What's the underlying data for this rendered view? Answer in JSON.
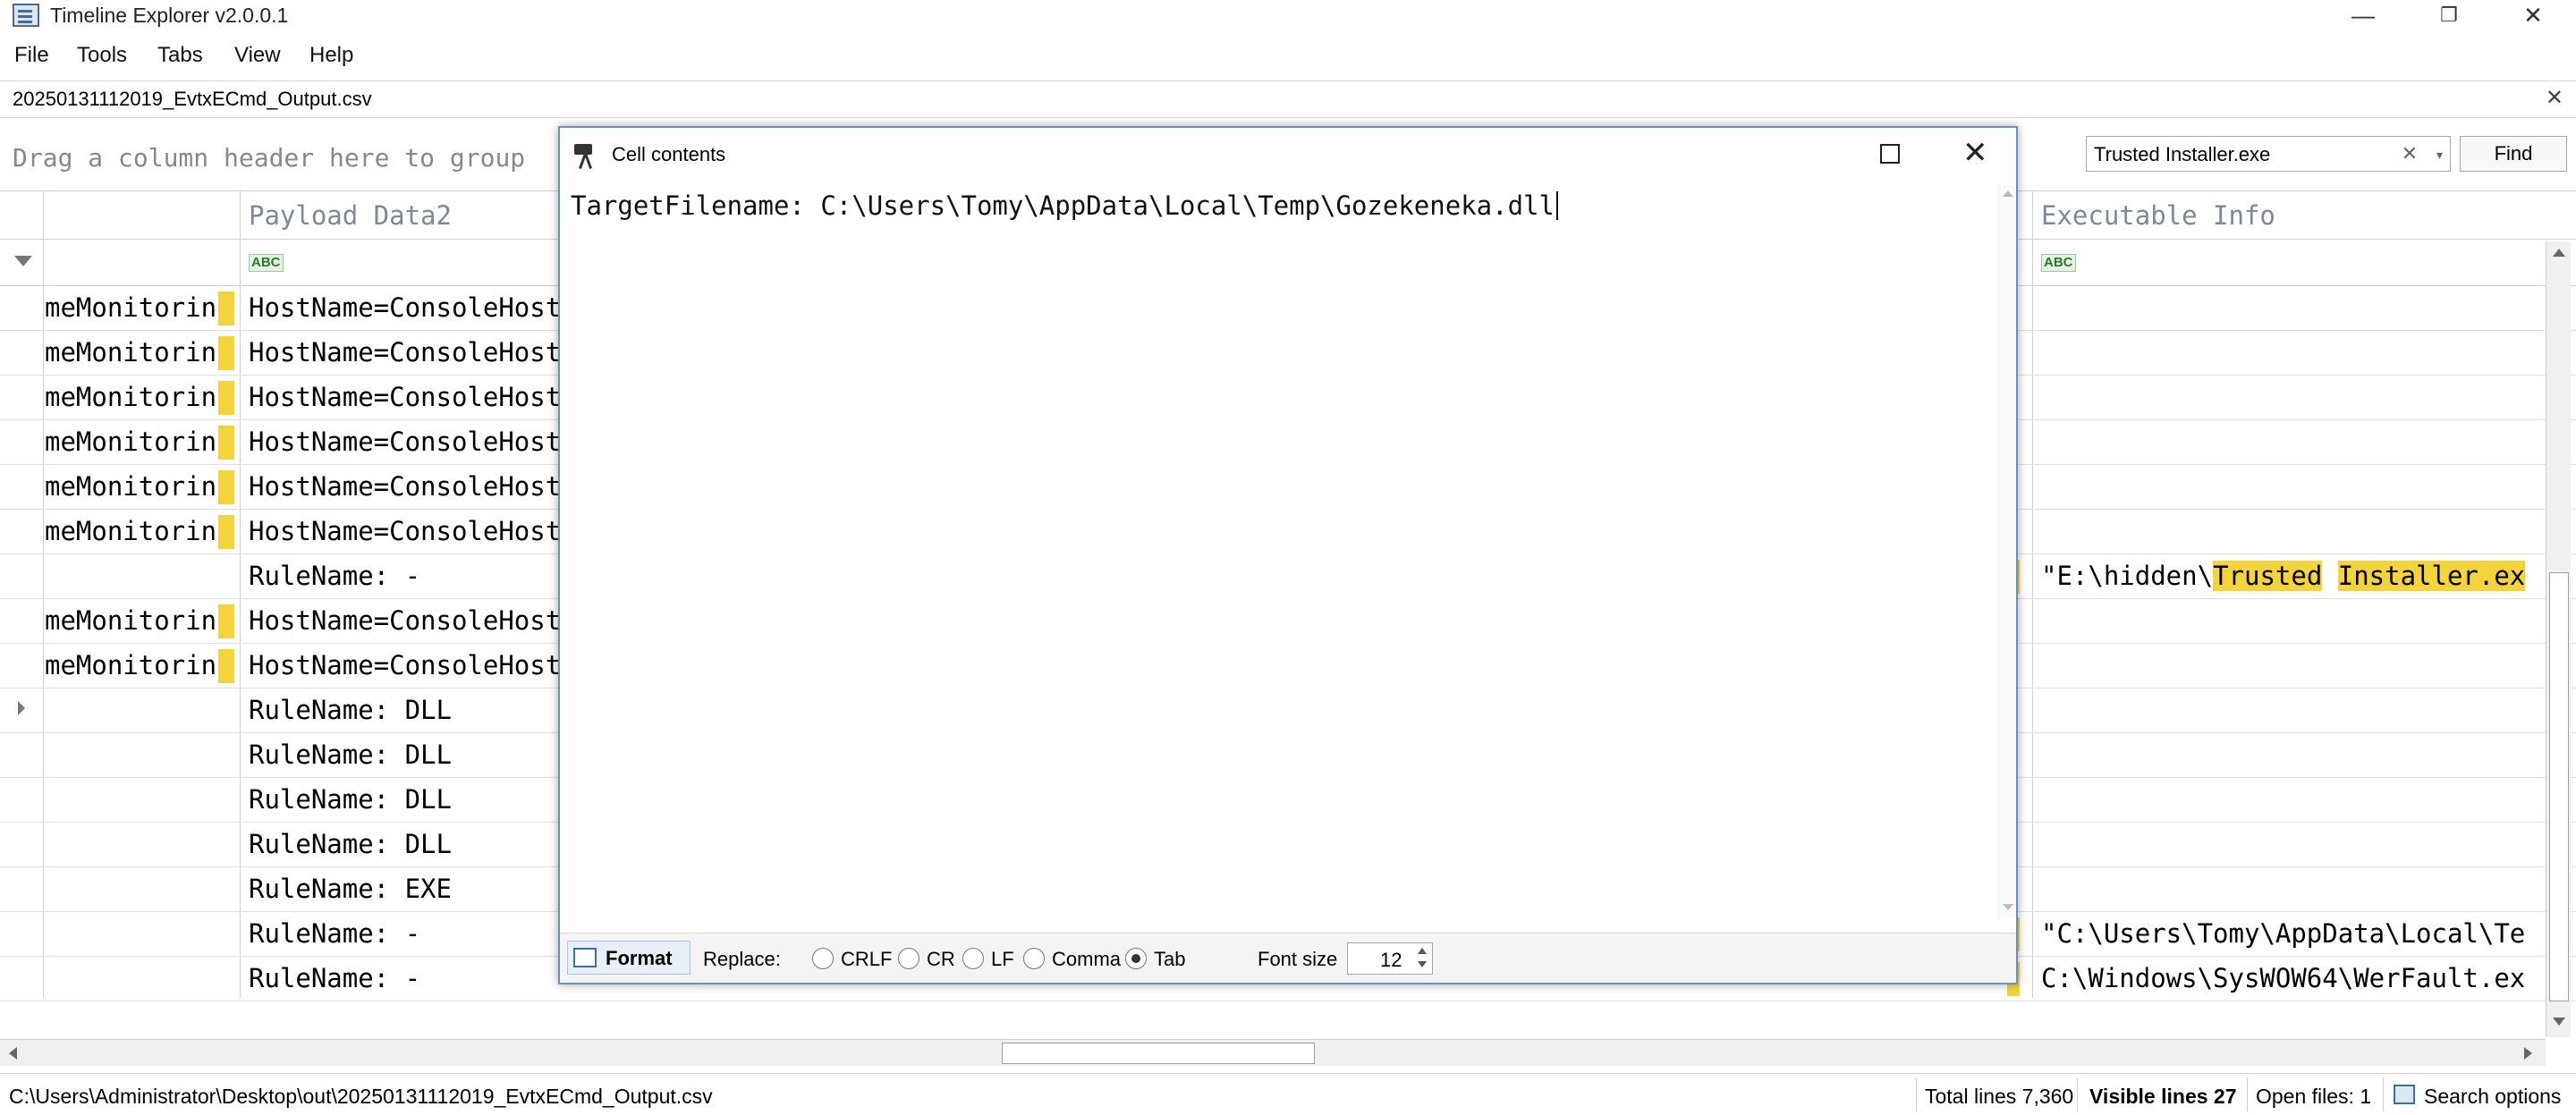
{
  "window": {
    "title": "Timeline Explorer v2.0.0.1",
    "minimize": "—",
    "restore": "❐",
    "close": "✕"
  },
  "menu": [
    "File",
    "Tools",
    "Tabs",
    "View",
    "Help"
  ],
  "file_tab": {
    "label": "20250131112019_EvtxECmd_Output.csv",
    "close": "✕"
  },
  "group_hint": "Drag a column header here to group",
  "search": {
    "value": "Trusted Installer.exe",
    "clear": "✕",
    "dropdown": "▾",
    "find_label": "Find"
  },
  "columns": {
    "payload_data2": "Payload Data2",
    "executable_info": "Executable Info"
  },
  "rows": [
    {
      "c1": "meMonitorin",
      "c2": "HostName=ConsoleHost",
      "c8": ""
    },
    {
      "c1": "meMonitorin",
      "c2": "HostName=ConsoleHost",
      "c8": ""
    },
    {
      "c1": "meMonitorin",
      "c2": "HostName=ConsoleHost",
      "c8": ""
    },
    {
      "c1": "meMonitorin",
      "c2": "HostName=ConsoleHost",
      "c8": ""
    },
    {
      "c1": "meMonitorin",
      "c2": "HostName=ConsoleHost",
      "c8": ""
    },
    {
      "c1": "meMonitorin",
      "c2": "HostName=ConsoleHost",
      "c8": ""
    },
    {
      "c1": "",
      "c2": "RuleName: -",
      "c8_pre": "\"E:\\hidden\\",
      "c8_hl1": "Trusted",
      "c8_sp": " ",
      "c8_hl2": "Installer.ex"
    },
    {
      "c1": "meMonitorin",
      "c2": "HostName=ConsoleHost",
      "c8": ""
    },
    {
      "c1": "meMonitorin",
      "c2": "HostName=ConsoleHost",
      "c8": ""
    },
    {
      "c1": "",
      "c2": "RuleName: DLL",
      "c8": ""
    },
    {
      "c1": "",
      "c2": "RuleName: DLL",
      "c8": ""
    },
    {
      "c1": "",
      "c2": "RuleName: DLL",
      "c8": ""
    },
    {
      "c1": "",
      "c2": "RuleName: DLL",
      "c8": ""
    },
    {
      "c1": "",
      "c2": "RuleName: EXE",
      "c8": ""
    },
    {
      "c1": "",
      "c2": "RuleName: -",
      "c8": "\"C:\\Users\\Tomy\\AppData\\Local\\Te"
    },
    {
      "c1": "",
      "c2": "RuleName: -",
      "c8": "C:\\Windows\\SysWOW64\\WerFault.ex"
    }
  ],
  "status": {
    "path": "C:\\Users\\Administrator\\Desktop\\out\\20250131112019_EvtxECmd_Output.csv",
    "total_lines": "Total lines 7,360",
    "visible_lines": "Visible lines 27",
    "open_files": "Open files: 1",
    "search_options": "Search options"
  },
  "dialog": {
    "title": "Cell contents",
    "content": "TargetFilename: C:\\Users\\Tomy\\AppData\\Local\\Temp\\Gozekeneka.dll",
    "close": "✕",
    "format_label": "Format",
    "replace_label": "Replace:",
    "options": [
      "CRLF",
      "CR",
      "LF",
      "Comma",
      "Tab"
    ],
    "selected_option": "Tab",
    "font_size_label": "Font size",
    "font_size": "12"
  }
}
